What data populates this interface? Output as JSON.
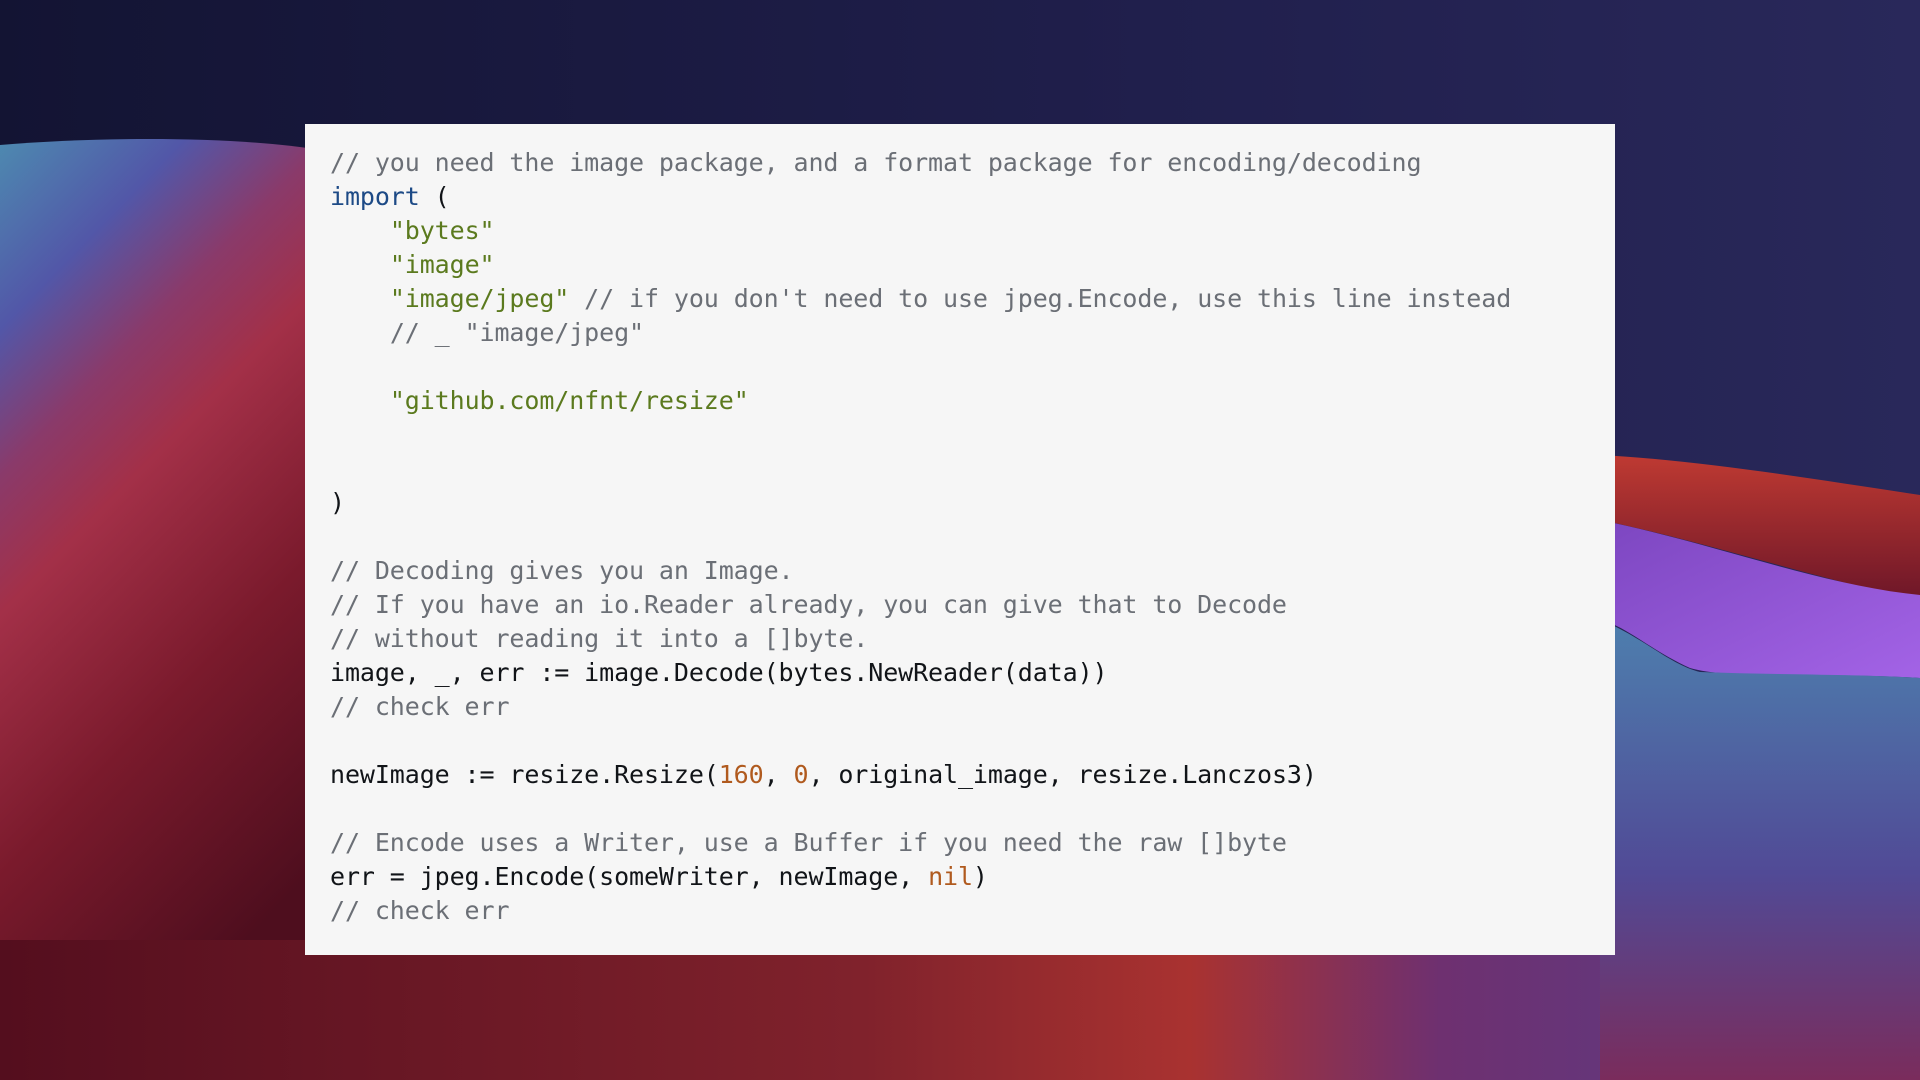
{
  "wallpaper": {
    "description": "abstract layered waves desktop wallpaper",
    "colors": {
      "sky_dark": "#151735",
      "sky_mid": "#262656",
      "red": "#b0302e",
      "maroon": "#5a1020",
      "violet": "#9a5ee0",
      "teal_blue": "#4b82ac",
      "indigo": "#4f4a9a"
    }
  },
  "code_block": {
    "language": "go",
    "colors": {
      "background": "#f6f6f6",
      "comment": "#6b6f76",
      "keyword": "#1d4a86",
      "string": "#5b7a1e",
      "number": "#b05a1e",
      "plain": "#111418"
    },
    "lines": [
      [
        {
          "t": "comment",
          "v": "// you need the image package, and a format package for encoding/decoding"
        }
      ],
      [
        {
          "t": "keyword",
          "v": "import"
        },
        {
          "t": "plain",
          "v": " ("
        }
      ],
      [
        {
          "t": "plain",
          "v": "    "
        },
        {
          "t": "string",
          "v": "\"bytes\""
        }
      ],
      [
        {
          "t": "plain",
          "v": "    "
        },
        {
          "t": "string",
          "v": "\"image\""
        }
      ],
      [
        {
          "t": "plain",
          "v": "    "
        },
        {
          "t": "string",
          "v": "\"image/jpeg\""
        },
        {
          "t": "comment",
          "v": " // if you don't need to use jpeg.Encode, use this line instead"
        }
      ],
      [
        {
          "t": "plain",
          "v": "    "
        },
        {
          "t": "comment",
          "v": "// _ \"image/jpeg\""
        }
      ],
      [],
      [
        {
          "t": "plain",
          "v": "    "
        },
        {
          "t": "string",
          "v": "\"github.com/nfnt/resize\""
        }
      ],
      [],
      [],
      [
        {
          "t": "plain",
          "v": ")"
        }
      ],
      [],
      [
        {
          "t": "comment",
          "v": "// Decoding gives you an Image."
        }
      ],
      [
        {
          "t": "comment",
          "v": "// If you have an io.Reader already, you can give that to Decode"
        }
      ],
      [
        {
          "t": "comment",
          "v": "// without reading it into a []byte."
        }
      ],
      [
        {
          "t": "plain",
          "v": "image, _, err := image.Decode(bytes.NewReader(data))"
        }
      ],
      [
        {
          "t": "comment",
          "v": "// check err"
        }
      ],
      [],
      [
        {
          "t": "plain",
          "v": "newImage := resize.Resize("
        },
        {
          "t": "number",
          "v": "160"
        },
        {
          "t": "plain",
          "v": ", "
        },
        {
          "t": "number",
          "v": "0"
        },
        {
          "t": "plain",
          "v": ", original_image, resize.Lanczos3)"
        }
      ],
      [],
      [
        {
          "t": "comment",
          "v": "// Encode uses a Writer, use a Buffer if you need the raw []byte"
        }
      ],
      [
        {
          "t": "plain",
          "v": "err = jpeg.Encode(someWriter, newImage, "
        },
        {
          "t": "number",
          "v": "nil"
        },
        {
          "t": "plain",
          "v": ")"
        }
      ],
      [
        {
          "t": "comment",
          "v": "// check err"
        }
      ]
    ]
  }
}
